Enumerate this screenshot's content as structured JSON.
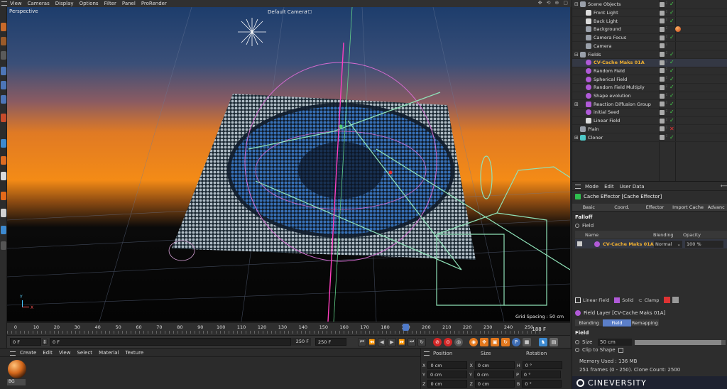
{
  "menubar": {
    "items": [
      "View",
      "Cameras",
      "Display",
      "Options",
      "Filter",
      "Panel",
      "ProRender"
    ],
    "nav_icons": [
      "move-view-icon",
      "rotate-view-icon",
      "zoom-view-icon",
      "maximize-view-icon"
    ]
  },
  "viewport": {
    "mode_label": "Perspective",
    "camera_label": "Default Camera",
    "camera_badge": "•□",
    "grid_spacing": "Grid Spacing : 50 cm",
    "axis_y": "Y",
    "axis_x": "X",
    "colors": {
      "sky_top": "#1b3a66",
      "horizon": "#f08a1a",
      "ground": "#050505"
    }
  },
  "timeline": {
    "ticks": [
      "0",
      "10",
      "20",
      "30",
      "40",
      "50",
      "60",
      "70",
      "80",
      "90",
      "100",
      "110",
      "120",
      "130",
      "140",
      "150",
      "160",
      "170",
      "180",
      "190",
      "200",
      "210",
      "220",
      "230",
      "240",
      "250"
    ],
    "current_frame_marker": "180",
    "frame_readout": "188 F"
  },
  "transport": {
    "start_field": "0 F",
    "current_field": "0 F",
    "end_field": "250 F",
    "max_field": "250 F",
    "buttons": [
      "⏮",
      "⏪",
      "◀",
      "▶",
      "⏩",
      "⏭",
      "↻"
    ]
  },
  "material_panel": {
    "menu": [
      "Create",
      "Edit",
      "View",
      "Select",
      "Material",
      "Texture"
    ],
    "materials": [
      {
        "name": "BG"
      }
    ]
  },
  "coordinates": {
    "headers": [
      "Position",
      "Size",
      "Rotation"
    ],
    "rows": [
      {
        "axis": "X",
        "pos": "0 cm",
        "size_axis": "X",
        "size": "0 cm",
        "rot_axis": "H",
        "rot": "0 °"
      },
      {
        "axis": "Y",
        "pos": "0 cm",
        "size_axis": "Y",
        "size": "0 cm",
        "rot_axis": "P",
        "rot": "0 °"
      },
      {
        "axis": "Z",
        "pos": "0 cm",
        "size_axis": "Z",
        "size": "0 cm",
        "rot_axis": "B",
        "rot": "0 °"
      }
    ]
  },
  "object_manager": {
    "items": [
      {
        "name": "Scene Objects",
        "indent": 0,
        "icon": "null-icon",
        "color": "#9aa0aa",
        "flag": "check",
        "expand": "⊟"
      },
      {
        "name": "Front Light",
        "indent": 1,
        "icon": "light-icon",
        "color": "#dcdcdc",
        "flag": "check",
        "expand": ""
      },
      {
        "name": "Back Light",
        "indent": 1,
        "icon": "light-icon",
        "color": "#dcdcdc",
        "flag": "check",
        "expand": ""
      },
      {
        "name": "Background",
        "indent": 1,
        "icon": "background-icon",
        "color": "#9aa0aa",
        "flag": "none",
        "expand": "",
        "material": true
      },
      {
        "name": "Camera Focus",
        "indent": 1,
        "icon": "null-icon",
        "color": "#9aa0aa",
        "flag": "check",
        "expand": ""
      },
      {
        "name": "Camera",
        "indent": 1,
        "icon": "camera-icon",
        "color": "#9aa0aa",
        "flag": "none",
        "expand": ""
      },
      {
        "name": "Fields",
        "indent": 0,
        "icon": "null-icon",
        "color": "#9aa0aa",
        "flag": "check",
        "expand": "⊟"
      },
      {
        "name": "CV-Cache Maks 01A",
        "indent": 1,
        "icon": "field-icon",
        "color": "#b05ad8",
        "flag": "check",
        "expand": "",
        "highlight": true
      },
      {
        "name": "Random Field",
        "indent": 1,
        "icon": "field-icon",
        "color": "#b05ad8",
        "flag": "check",
        "expand": ""
      },
      {
        "name": "Spherical Field",
        "indent": 1,
        "icon": "field-icon",
        "color": "#b05ad8",
        "flag": "check",
        "expand": ""
      },
      {
        "name": "Random Field Multiply",
        "indent": 1,
        "icon": "field-icon",
        "color": "#b05ad8",
        "flag": "check",
        "expand": ""
      },
      {
        "name": "Shape evolution",
        "indent": 1,
        "icon": "field-icon",
        "color": "#b05ad8",
        "flag": "check",
        "expand": ""
      },
      {
        "name": "Reaction Diffusion Group",
        "indent": 1,
        "icon": "folder-icon",
        "color": "#b05ad8",
        "flag": "check",
        "expand": "⊞"
      },
      {
        "name": "initial Seed",
        "indent": 1,
        "icon": "field-icon",
        "color": "#b05ad8",
        "flag": "check",
        "expand": ""
      },
      {
        "name": "Linear Field",
        "indent": 1,
        "icon": "linear-field-icon",
        "color": "#dcdcdc",
        "flag": "check",
        "expand": ""
      },
      {
        "name": "Plain",
        "indent": 0,
        "icon": "effector-icon",
        "color": "#9aa0aa",
        "flag": "cross",
        "expand": ""
      },
      {
        "name": "Cloner",
        "indent": 0,
        "icon": "cloner-icon",
        "color": "#4ec7c7",
        "flag": "check",
        "expand": "⊞"
      }
    ]
  },
  "attribute_manager": {
    "menu": [
      "Mode",
      "Edit",
      "User Data"
    ],
    "title": "Cache Effector [Cache Effector]",
    "tabs": [
      "Basic",
      "Coord.",
      "Effector",
      "Import Cache",
      "Advanc"
    ],
    "falloff_label": "Falloff",
    "field_label": "Field",
    "columns": [
      "Name",
      "Blending",
      "Opacity"
    ],
    "field_row": {
      "name": "CV-Cache Maks 01A",
      "blending": "Normal",
      "opacity": "100 %"
    },
    "field_tools": [
      "Linear Field",
      "Solid",
      "Clamp"
    ],
    "layer_title": "Field Layer [CV-Cache Maks 01A]",
    "layer_tabs": [
      "Blending",
      "Field",
      "Remapping"
    ],
    "layer_section": "Field",
    "size_label": "Size",
    "size_value": "50 cm",
    "size_fraction": 0.95,
    "clip_label": "Clip to Shape",
    "memory": "Memory Used : 136 MB",
    "frames_info": "251 frames (0 - 250).  Clone Count: 2500"
  },
  "branding": {
    "logo_text": "CINEVERSITY"
  }
}
